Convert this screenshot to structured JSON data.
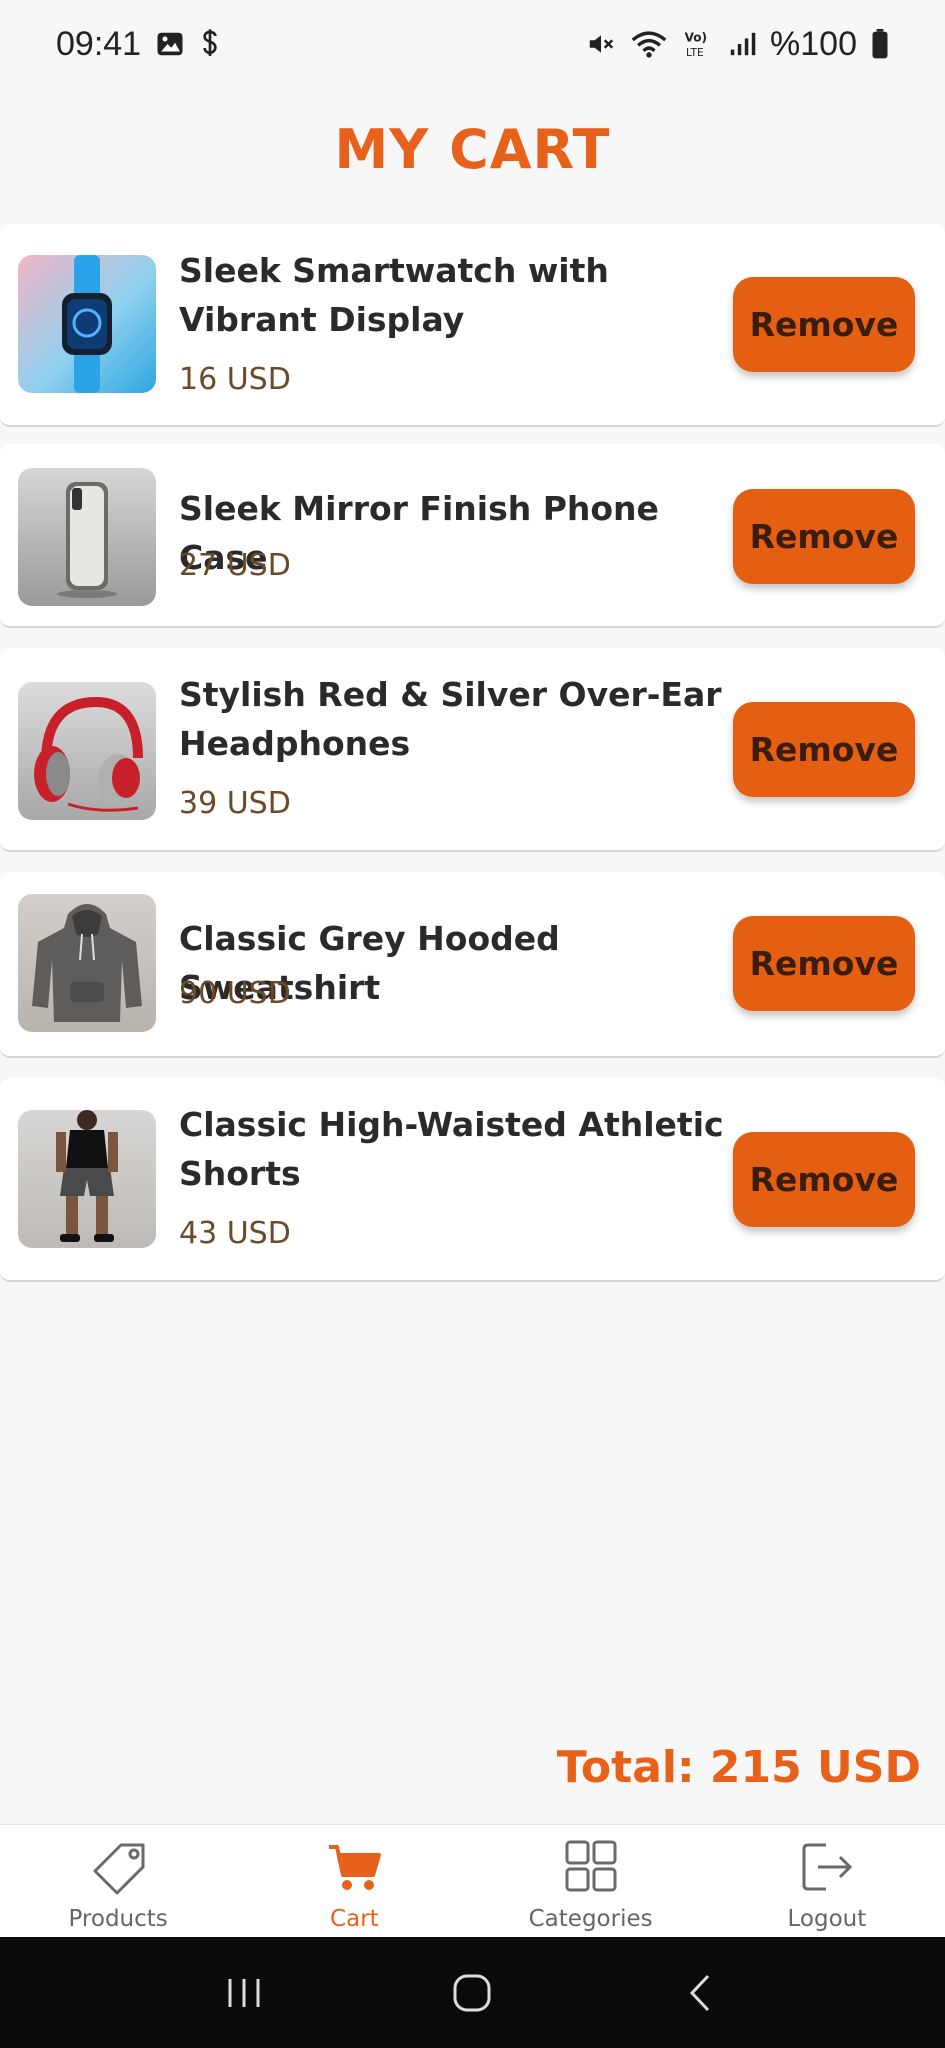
{
  "status_bar": {
    "time": "09:41",
    "battery": "%100",
    "icons": [
      "image-icon",
      "dollar-icon",
      "mute-icon",
      "wifi-icon",
      "volte-icon",
      "signal-icon",
      "battery-icon"
    ]
  },
  "page": {
    "title": "MY CART"
  },
  "cart": {
    "items": [
      {
        "name": "Sleek Smartwatch with Vibrant Display",
        "price": "16 USD",
        "image": "smartwatch-image",
        "remove_label": "Remove"
      },
      {
        "name": "Sleek Mirror Finish Phone Case",
        "price": "27 USD",
        "image": "phone-case-image",
        "remove_label": "Remove"
      },
      {
        "name": "Stylish Red & Silver Over-Ear Headphones",
        "price": "39 USD",
        "image": "headphones-image",
        "remove_label": "Remove"
      },
      {
        "name": "Classic Grey Hooded Sweatshirt",
        "price": "90 USD",
        "image": "hoodie-image",
        "remove_label": "Remove"
      },
      {
        "name": "Classic High-Waisted Athletic Shorts",
        "price": "43 USD",
        "image": "shorts-image",
        "remove_label": "Remove"
      }
    ],
    "total": "Total: 215 USD"
  },
  "bottom_nav": {
    "items": [
      {
        "label": "Products",
        "icon": "tag-icon"
      },
      {
        "label": "Cart",
        "icon": "cart-icon",
        "active": true
      },
      {
        "label": "Categories",
        "icon": "grid-icon"
      },
      {
        "label": "Logout",
        "icon": "logout-icon"
      }
    ]
  },
  "colors": {
    "accent": "#e8611a",
    "button": "#e55f12",
    "price": "#6b4a2a"
  }
}
